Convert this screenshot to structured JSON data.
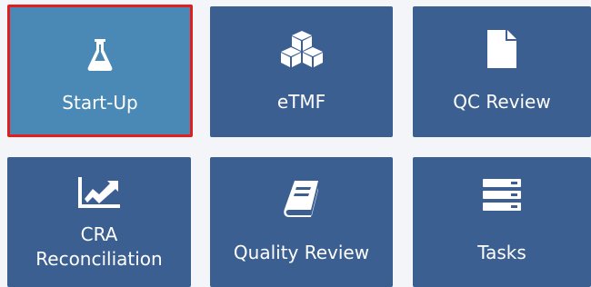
{
  "colors": {
    "page_background": "#f3f5f8",
    "tile_background": "#3b5f91",
    "selected_tile_background": "#4a88b5",
    "selection_outline": "#e11d1d",
    "text": "#ffffff"
  },
  "tiles": [
    {
      "label": "Start-Up",
      "icon": "flask-icon",
      "selected": true
    },
    {
      "label": "eTMF",
      "icon": "cubes-icon",
      "selected": false
    },
    {
      "label": "QC Review",
      "icon": "document-icon",
      "selected": false
    },
    {
      "label": "CRA\nReconciliation",
      "icon": "line-chart-icon",
      "selected": false
    },
    {
      "label": "Quality Review",
      "icon": "book-icon",
      "selected": false
    },
    {
      "label": "Tasks",
      "icon": "tasks-icon",
      "selected": false
    }
  ]
}
